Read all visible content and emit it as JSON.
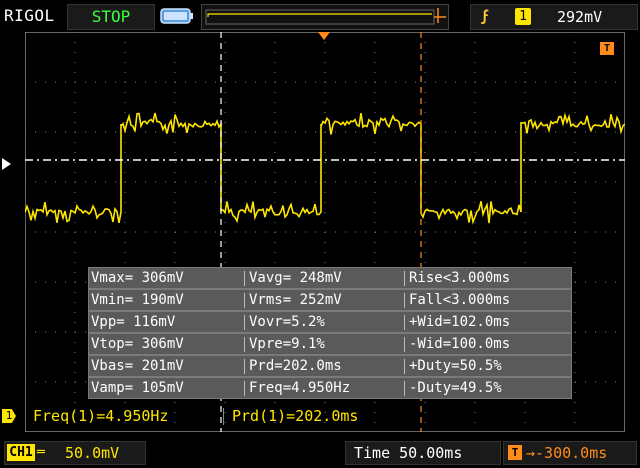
{
  "header": {
    "brand": "RIGOL",
    "run_state": "STOP",
    "trigger": {
      "edge_symbol": "ϝ",
      "channel": "1",
      "level": "292mV"
    }
  },
  "markers": {
    "trigger_level_tag": "T",
    "channel_tag": "1",
    "offset_tag": "T"
  },
  "measurements": [
    [
      "Vmax= 306mV",
      "Vavg= 248mV",
      "Rise<3.000ms"
    ],
    [
      "Vmin= 190mV",
      "Vrms= 252mV",
      "Fall<3.000ms"
    ],
    [
      "Vpp= 116mV",
      "Vovr=5.2%",
      "+Wid=102.0ms"
    ],
    [
      "Vtop= 306mV",
      "Vpre=9.1%",
      "-Wid=100.0ms"
    ],
    [
      "Vbas= 201mV",
      "Prd=202.0ms",
      "+Duty=50.5%"
    ],
    [
      "Vamp= 105mV",
      "Freq=4.950Hz",
      "-Duty=49.5%"
    ]
  ],
  "info_line": {
    "freq": "Freq(1)=4.950Hz",
    "prd": "Prd(1)=202.0ms"
  },
  "status_bar": {
    "ch1_label": "CH1",
    "ch1_coupling": "═",
    "ch1_scale": "50.0mV",
    "time": "Time 50.00ms",
    "offset": "→-300.0ms"
  },
  "colors": {
    "trace": "#ffe600",
    "trigger": "#ff8c1a",
    "run_state": "#3cff3c"
  }
}
